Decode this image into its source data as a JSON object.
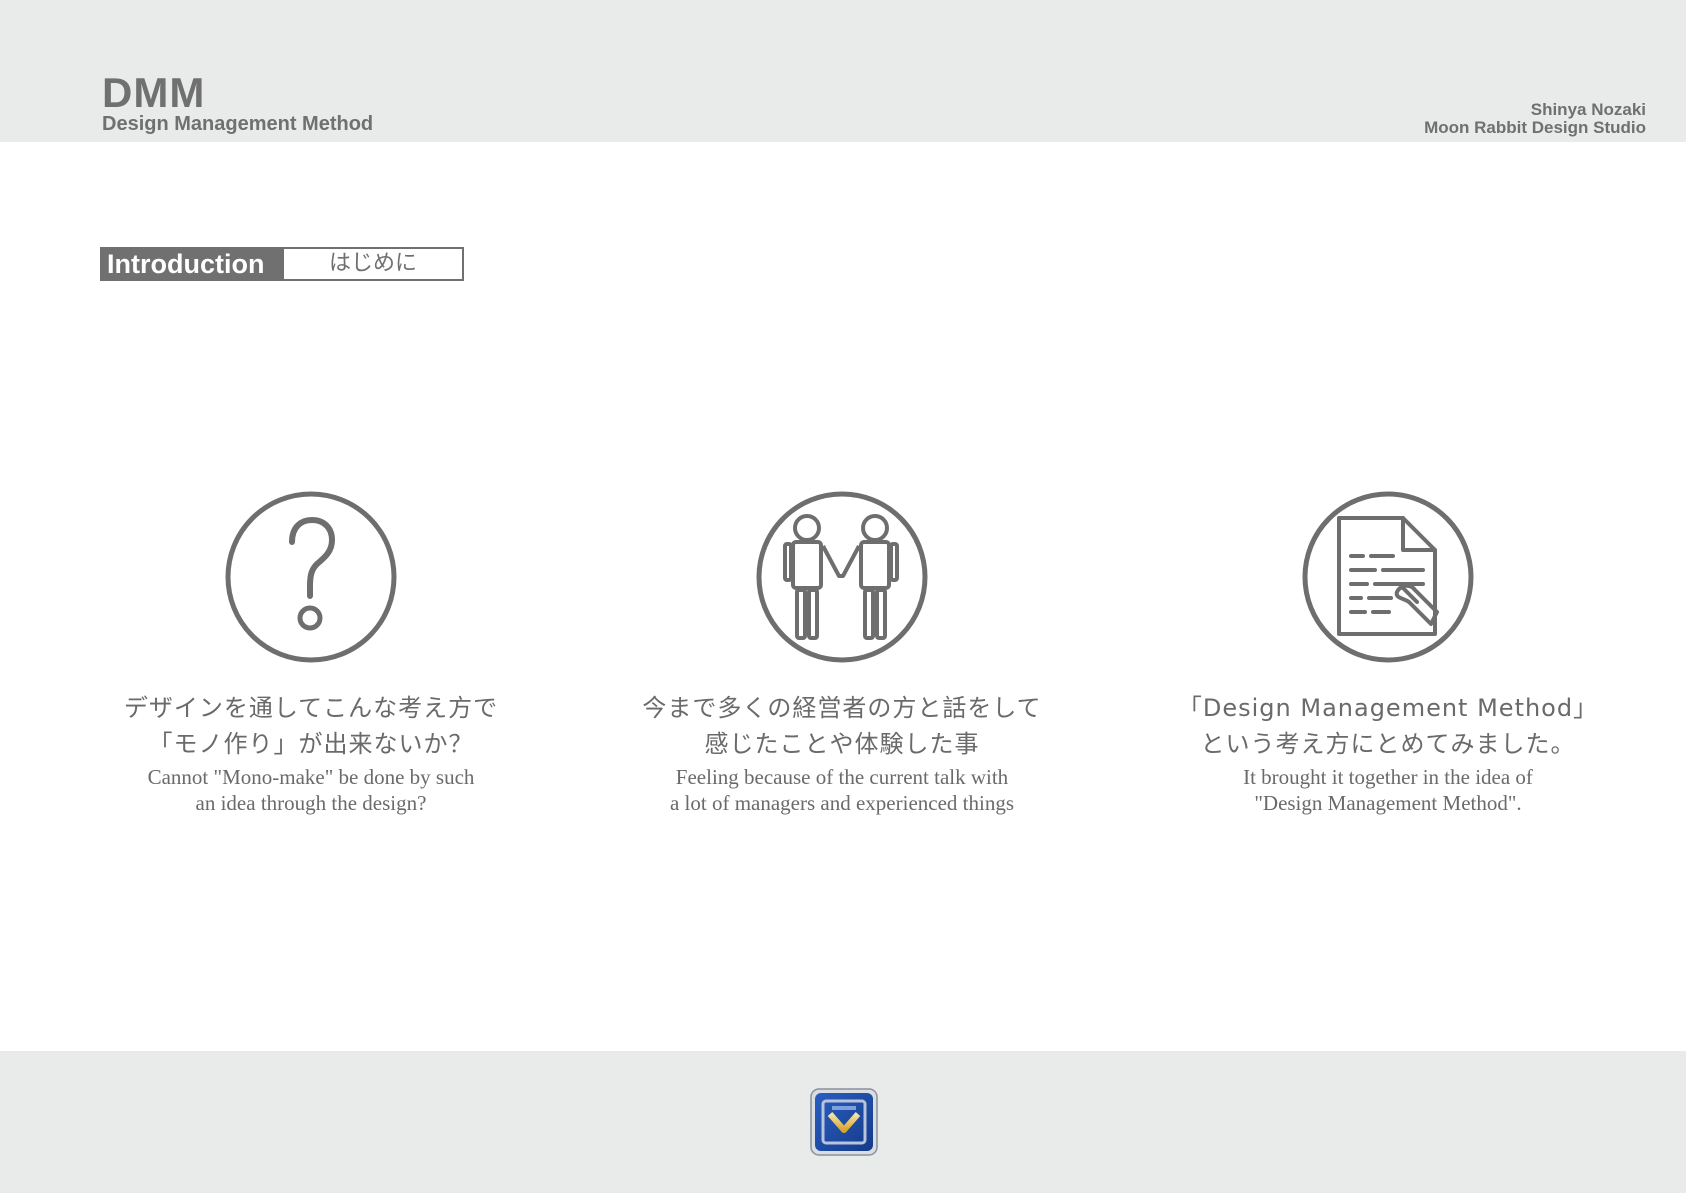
{
  "header": {
    "title": "DMM",
    "subtitle": "Design Management Method",
    "author_name": "Shinya Nozaki",
    "author_studio": "Moon Rabbit Design Studio"
  },
  "section": {
    "label_en": "Introduction",
    "label_ja": "はじめに"
  },
  "columns": [
    {
      "icon": "question-mark-icon",
      "jp_line1": "デザインを通してこんな考え方で",
      "jp_line2": "「モノ作り」が出来ないか？",
      "en_line1": "Cannot \"Mono-make\" be done by such",
      "en_line2": "an idea through the design?"
    },
    {
      "icon": "two-people-icon",
      "jp_line1": "今まで多くの経営者の方と話をして",
      "jp_line2": "感じたことや体験した事",
      "en_line1": "Feeling because of the current talk with",
      "en_line2": "a lot of managers and experienced things"
    },
    {
      "icon": "document-pen-icon",
      "jp_line1": "「Design Management Method」",
      "jp_line2": "という考え方にとめてみました。",
      "en_line1": "It brought it together in the idea of",
      "en_line2": "\"Design Management Method\"."
    }
  ],
  "colors": {
    "band": "#e9eaea",
    "ink": "#707070"
  }
}
